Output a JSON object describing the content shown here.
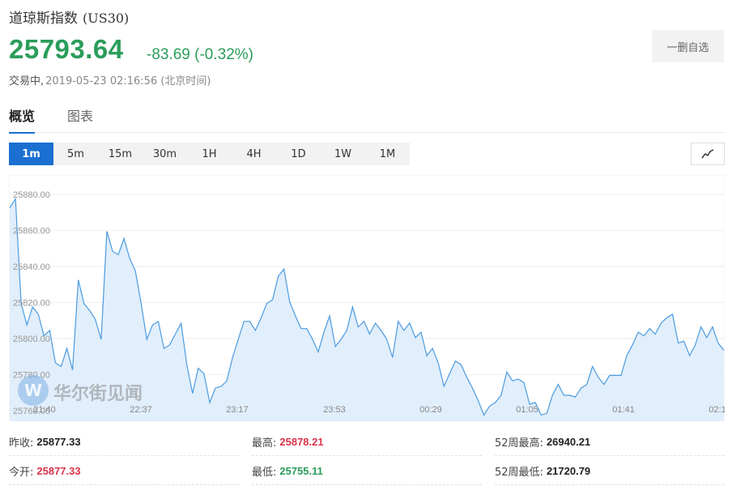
{
  "header": {
    "name": "道琼斯指数",
    "code": "(US30)",
    "price": "25793.64",
    "change": "-83.69 (-0.32%)",
    "status": "交易中,",
    "timestamp": "2019-05-23 02:16:56 (北京时间)",
    "watch_button": "一删自选"
  },
  "tabs": [
    "概览",
    "图表"
  ],
  "intervals": [
    "1m",
    "5m",
    "15m",
    "30m",
    "1H",
    "4H",
    "1D",
    "1W",
    "1M"
  ],
  "watermark": "华尔街见闻",
  "colors": {
    "up": "#d9344b",
    "down": "#2a9d5a",
    "accent": "#1a6fd1",
    "line": "#4a9be0",
    "area": "#dcebfa"
  },
  "chart_data": {
    "type": "area",
    "ylim": [
      25760,
      25885
    ],
    "yticks": [
      "25880.00",
      "25860.00",
      "25840.00",
      "25820.00",
      "25800.00",
      "25780.00",
      "25760.00"
    ],
    "yvals": [
      25880,
      25860,
      25840,
      25820,
      25800,
      25780,
      25760
    ],
    "xticks": [
      "21:40",
      "22:37",
      "23:17",
      "23:53",
      "00:29",
      "01:05",
      "01:41",
      "02:1"
    ],
    "values": [
      25873,
      25878,
      25820,
      25808,
      25818,
      25814,
      25802,
      25805,
      25787,
      25785,
      25795,
      25783,
      25833,
      25820,
      25816,
      25811,
      25800,
      25860,
      25849,
      25847,
      25856,
      25845,
      25838,
      25820,
      25800,
      25808,
      25810,
      25795,
      25797,
      25803,
      25809,
      25786,
      25770,
      25784,
      25781,
      25765,
      25773,
      25774,
      25777,
      25790,
      25800,
      25810,
      25810,
      25805,
      25812,
      25820,
      25822,
      25835,
      25839,
      25821,
      25813,
      25806,
      25806,
      25800,
      25793,
      25804,
      25813,
      25796,
      25800,
      25805,
      25818,
      25807,
      25810,
      25803,
      25809,
      25805,
      25800,
      25790,
      25810,
      25805,
      25809,
      25801,
      25804,
      25791,
      25795,
      25787,
      25774,
      25781,
      25788,
      25786,
      25779,
      25773,
      25766,
      25758,
      25763,
      25765,
      25769,
      25782,
      25777,
      25778,
      25776,
      25764,
      25765,
      25758,
      25759,
      25769,
      25775,
      25769,
      25769,
      25768,
      25773,
      25775,
      25785,
      25779,
      25775,
      25780,
      25780,
      25780,
      25791,
      25797,
      25804,
      25802,
      25806,
      25803,
      25809,
      25812,
      25814,
      25798,
      25799,
      25791,
      25797,
      25807,
      25801,
      25807,
      25798,
      25794
    ]
  },
  "stats": [
    {
      "label": "昨收:",
      "value": "25877.33",
      "color": "dark"
    },
    {
      "label": "最高:",
      "value": "25878.21",
      "color": "red"
    },
    {
      "label": "52周最高:",
      "value": "26940.21",
      "color": "dark"
    },
    {
      "label": "今开:",
      "value": "25877.33",
      "color": "red"
    },
    {
      "label": "最低:",
      "value": "25755.11",
      "color": "green"
    },
    {
      "label": "52周最低:",
      "value": "21720.79",
      "color": "dark"
    }
  ]
}
